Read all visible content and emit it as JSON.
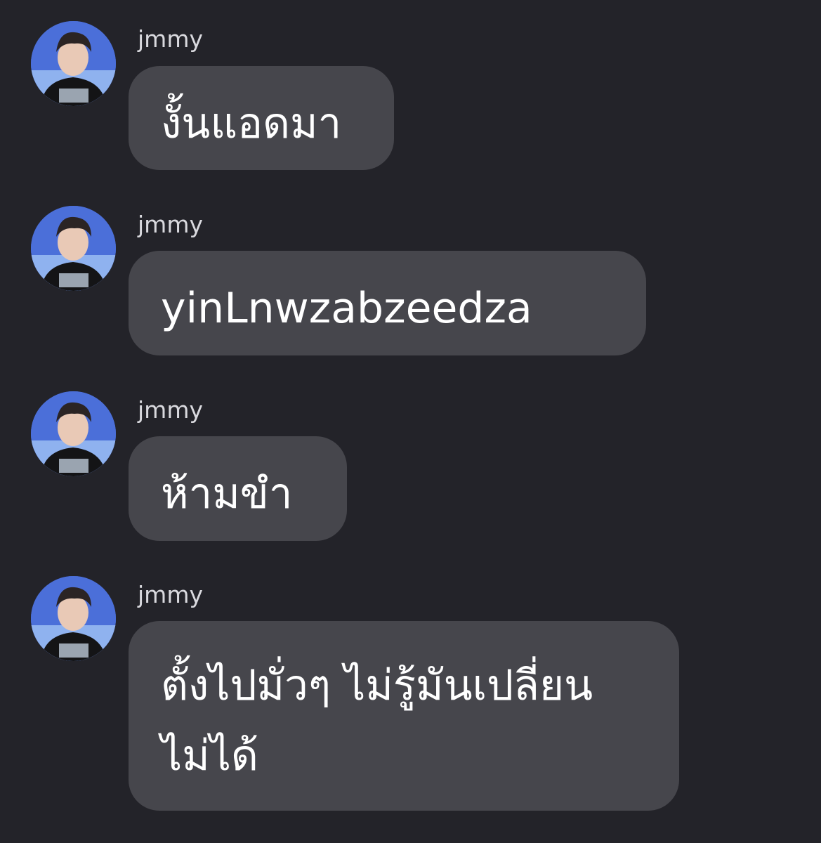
{
  "colors": {
    "background": "#232329",
    "bubble": "#46464c",
    "text": "#ffffff",
    "username": "#d9d9de"
  },
  "messages": [
    {
      "sender": "jmmy",
      "avatar_icon": "user-avatar-icon",
      "text": "งั้นแอดมา"
    },
    {
      "sender": "jmmy",
      "avatar_icon": "user-avatar-icon",
      "text": "yinLnwzabzeedza"
    },
    {
      "sender": "jmmy",
      "avatar_icon": "user-avatar-icon",
      "text": "ห้ามขำ"
    },
    {
      "sender": "jmmy",
      "avatar_icon": "user-avatar-icon",
      "text": "ตั้งไปมั่วๆ ไม่รู้มันเปลี่ยน\nไม่ได้"
    }
  ]
}
